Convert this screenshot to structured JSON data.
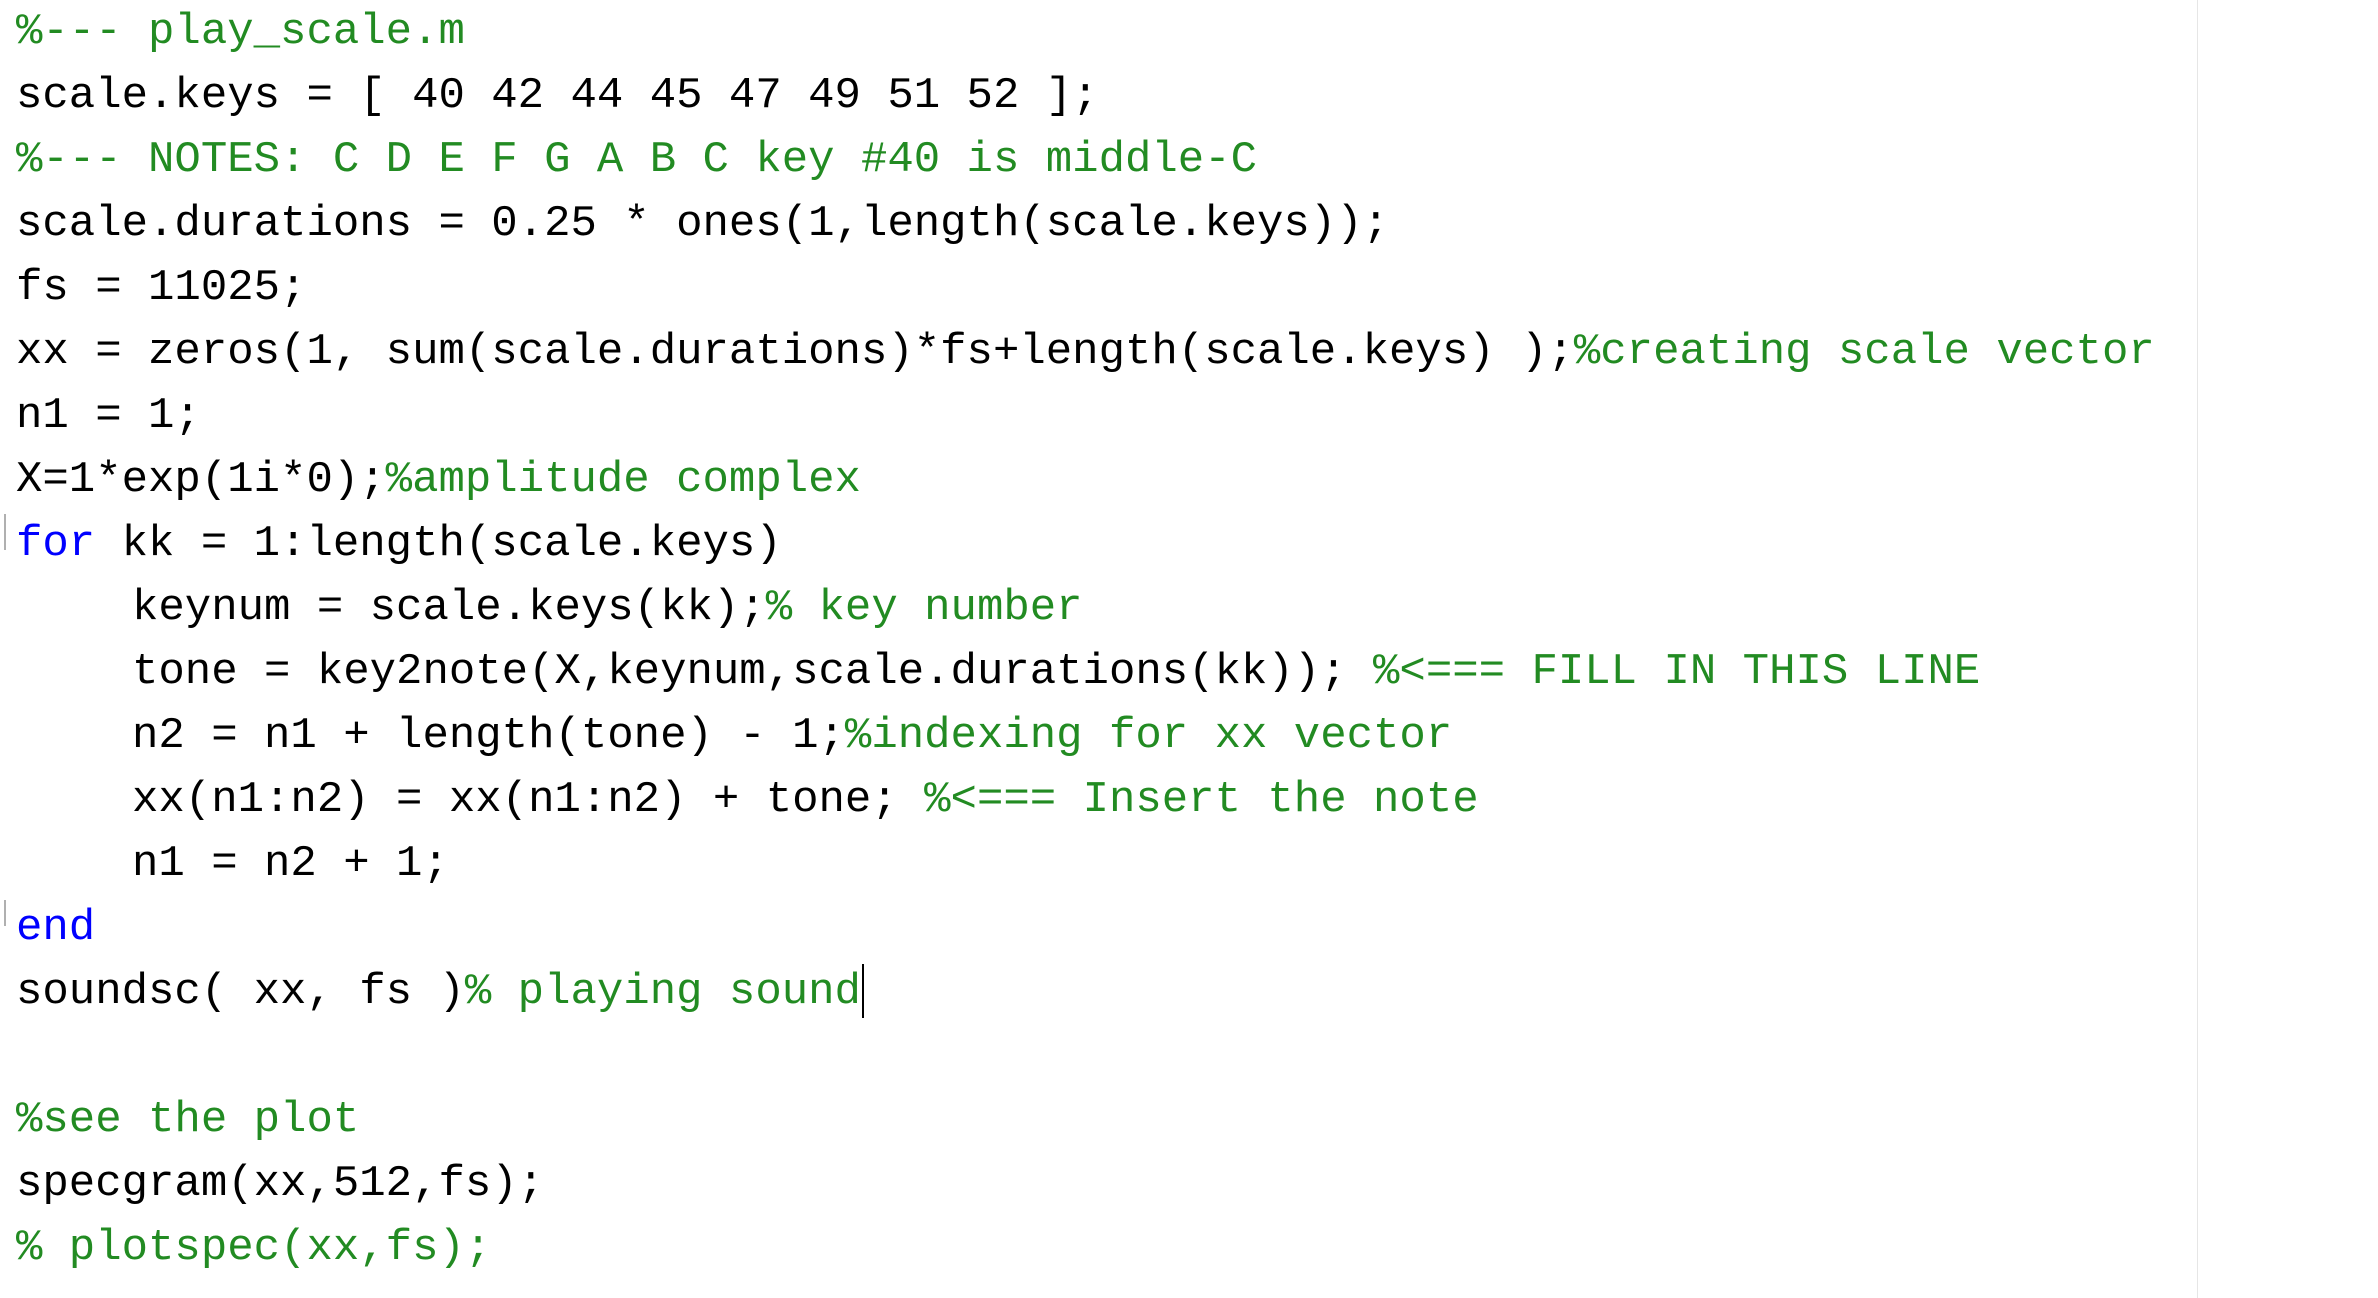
{
  "editor": {
    "lines": [
      [
        {
          "t": "%--- play_scale.m",
          "k": "comment"
        }
      ],
      [
        {
          "t": "scale.keys = [ 40 42 44 45 47 49 51 52 ];",
          "k": "code"
        }
      ],
      [
        {
          "t": "%--- NOTES: C D E F G A B C key #40 is middle-C",
          "k": "comment"
        }
      ],
      [
        {
          "t": "scale.durations = 0.25 * ones(1,length(scale.keys));",
          "k": "code"
        }
      ],
      [
        {
          "t": "fs = 11025;",
          "k": "code"
        }
      ],
      [
        {
          "t": "xx = zeros(1, sum(scale.durations)*fs+length(scale.keys) );",
          "k": "code"
        },
        {
          "t": "%creating scale vector",
          "k": "comment"
        }
      ],
      [
        {
          "t": "n1 = 1;",
          "k": "code"
        }
      ],
      [
        {
          "t": "X=1*exp(1i*0);",
          "k": "code"
        },
        {
          "t": "%amplitude complex",
          "k": "comment"
        }
      ],
      [
        {
          "t": "for",
          "k": "keyword"
        },
        {
          "t": " kk = 1:length(scale.keys)",
          "k": "code"
        }
      ],
      [
        {
          "t": "keynum = scale.keys(kk);",
          "k": "code",
          "indent": true
        },
        {
          "t": "% key number",
          "k": "comment"
        }
      ],
      [
        {
          "t": "tone = key2note(X,keynum,scale.durations(kk)); ",
          "k": "code",
          "indent": true
        },
        {
          "t": "%<=== FILL IN THIS LINE",
          "k": "comment"
        }
      ],
      [
        {
          "t": "n2 = n1 + length(tone) - 1;",
          "k": "code",
          "indent": true
        },
        {
          "t": "%indexing for xx vector",
          "k": "comment"
        }
      ],
      [
        {
          "t": "xx(n1:n2) = xx(n1:n2) + tone; ",
          "k": "code",
          "indent": true
        },
        {
          "t": "%<=== Insert the note",
          "k": "comment"
        }
      ],
      [
        {
          "t": "n1 = n2 + 1;",
          "k": "code",
          "indent": true
        }
      ],
      [
        {
          "t": "end",
          "k": "keyword"
        }
      ],
      [
        {
          "t": "soundsc( xx, fs )",
          "k": "code"
        },
        {
          "t": "% playing sound",
          "k": "comment",
          "caret": true
        }
      ],
      [],
      [
        {
          "t": "%see the plot",
          "k": "comment"
        }
      ],
      [
        {
          "t": "specgram(xx,512,fs);",
          "k": "code"
        }
      ],
      [
        {
          "t": "% plotspec(xx,fs);",
          "k": "comment"
        }
      ]
    ]
  },
  "colors": {
    "comment": "#228B22",
    "keyword": "#0000FF",
    "code": "#000000",
    "background": "#FFFFFF"
  }
}
